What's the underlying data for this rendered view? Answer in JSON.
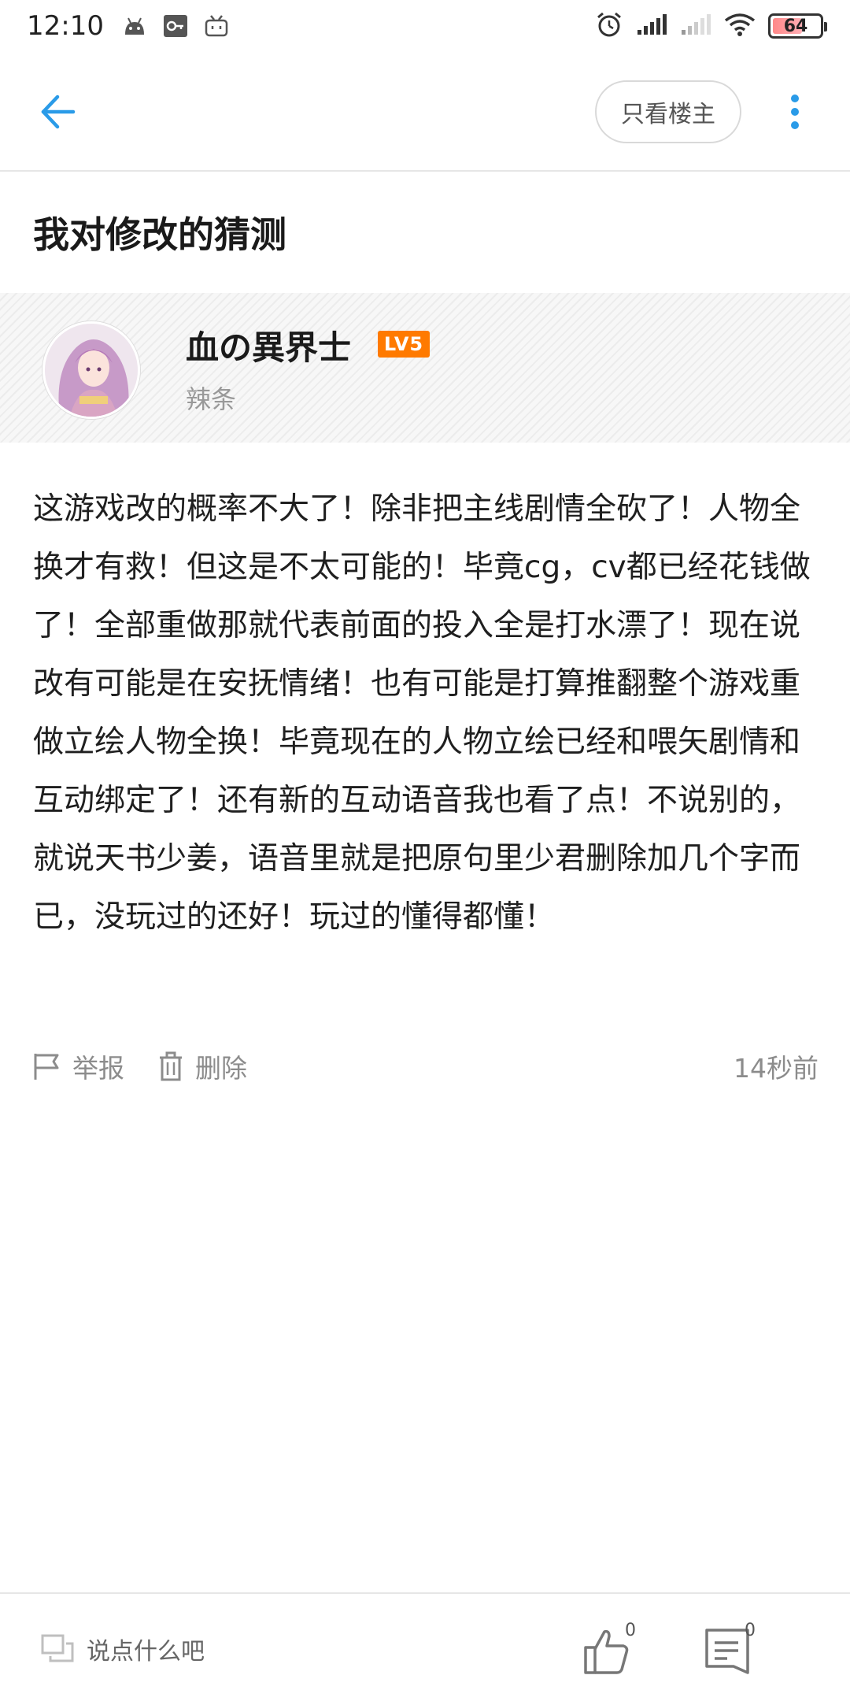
{
  "status_bar": {
    "time": "12:10",
    "battery_level": "64",
    "icons_left": [
      "android-icon",
      "key-icon",
      "bilibili-icon"
    ],
    "icons_right": [
      "alarm-icon",
      "signal-icon",
      "signal-weak-icon",
      "wifi-icon",
      "battery-icon"
    ]
  },
  "header": {
    "back_icon": "back-arrow-icon",
    "only_op_label": "只看楼主",
    "more_icon": "more-vertical-icon",
    "accent_color": "#2a9be8"
  },
  "post": {
    "title": "我对修改的猜测",
    "author": {
      "name": "血の異界士",
      "level": "LV5",
      "title": "辣条"
    },
    "body": "这游戏改的概率不大了！除非把主线剧情全砍了！人物全换才有救！但这是不太可能的！毕竟cg，cv都已经花钱做了！全部重做那就代表前面的投入全是打水漂了！现在说改有可能是在安抚情绪！也有可能是打算推翻整个游戏重做立绘人物全换！毕竟现在的人物立绘已经和喂矢剧情和互动绑定了！还有新的互动语音我也看了点！不说别的，就说天书少姜，语音里就是把原句里少君删除加几个字而已，没玩过的还好！玩过的懂得都懂！",
    "actions": {
      "report_label": "举报",
      "delete_label": "删除"
    },
    "timestamp": "14秒前"
  },
  "bottom_bar": {
    "comment_placeholder": "说点什么吧",
    "like_count": "0",
    "comment_count": "0"
  }
}
